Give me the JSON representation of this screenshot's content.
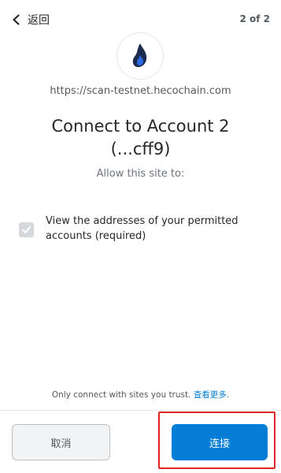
{
  "header": {
    "back_label": "返回",
    "step": "2 of 2"
  },
  "site": {
    "origin": "https://scan-testnet.hecochain.com",
    "logo_icon": "heco-flame-icon"
  },
  "title": {
    "line1": "Connect to Account 2",
    "line2": "(...cff9)"
  },
  "allow_text": "Allow this site to:",
  "permissions": [
    {
      "line1": "View the addresses of your permitted",
      "line2": "accounts (required)",
      "checked": true,
      "disabled": true
    }
  ],
  "footer": {
    "trust_text": "Only connect with sites you trust.",
    "learn_more": "查看更多."
  },
  "buttons": {
    "cancel": "取消",
    "connect": "连接"
  },
  "colors": {
    "primary": "#037dd6",
    "highlight": "#e02525",
    "logo_dark": "#1d2a4f",
    "logo_light": "#2b6ae0"
  }
}
